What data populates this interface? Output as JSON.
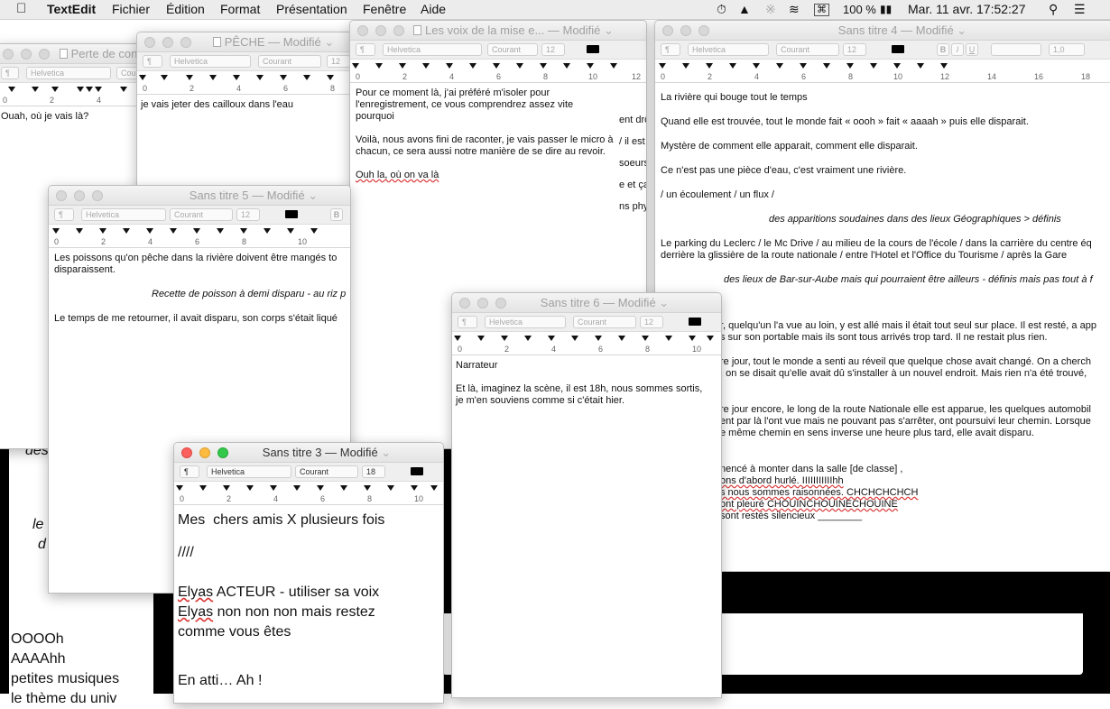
{
  "menubar": {
    "apple_icon": "apple-logo",
    "app_name": "TextEdit",
    "menus": [
      "Fichier",
      "Édition",
      "Format",
      "Présentation",
      "Fenêtre",
      "Aide"
    ],
    "status": {
      "battery": "100 %",
      "clock": "Mar. 11 avr.  17:52:27"
    }
  },
  "formatbar": {
    "style": "¶",
    "font": "Helvetica",
    "weight": "Courant",
    "size_12": "12",
    "size_18": "18",
    "bold": "B",
    "italic": "I",
    "underline": "U",
    "spacing": "1,0"
  },
  "windows": {
    "perte": {
      "title": "Perte de con",
      "lines": [
        "Ouah, où je vais là?"
      ]
    },
    "peche": {
      "title": "PÊCHE — Modifié",
      "lines": [
        "je vais jeter des cailloux dans l'eau"
      ]
    },
    "voix": {
      "title": "Les voix de la mise e... — Modifié",
      "paragraphs": [
        "Pour ce moment là, j'ai préféré m'isoler pour l'enregistrement, ce vous comprendrez assez vite pourquoi",
        "Voilà, nous avons fini de raconter, je vais passer le micro à chacun, ce sera aussi notre manière de se dire au revoir.",
        "Ouh la, où on va là"
      ],
      "peek_lines": [
        "ent drôle",
        "/ il est c",
        "soeurs c",
        "e et ça r",
        "ns phys"
      ]
    },
    "sans4": {
      "title": "Sans titre 4 — Modifié",
      "paragraphs": [
        "La rivière qui bouge tout le temps",
        "Quand elle est trouvée, tout le monde fait « oooh » fait « aaaah » puis elle disparait.",
        "Mystère de comment elle apparait, comment elle disparait.",
        "Ce n'est pas une pièce d'eau, c'est vraiment une rivière.",
        "/ un écoulement / un flux /"
      ],
      "center1": "des apparitions soudaines dans des lieux Géographiques > définis",
      "parking": "Le parking du Leclerc / le Mc Drive / au milieu de la cours de l'école / dans la carrière du centre éq",
      "parking2": "derrière la glissière de la route nationale / entre l'Hotel et l'Office du Tourisme / après la Gare",
      "center2": "des lieux de Bar-sur-Aube mais qui pourraient être ailleurs - définis mais pas tout à f",
      "visible_lines": [
        "r, quelqu'un l'a vue au loin, y est allé mais il était tout seul sur place. Il est resté, a app",
        "s sur son portable mais ils sont tous arrivés trop tard. Il ne restait plus rien.",
        "re jour, tout le monde a senti au réveil que quelque chose avait changé. On a cherch",
        ", on se disait qu'elle avait dû s'installer à un nouvel endroit. Mais rien n'a été trouvé,",
        "re jour encore, le long de la route Nationale elle est apparue, les quelques automobil",
        "ent par là l'ont vue mais ne pouvant pas s'arrêter, ont poursuivi leur chemin. Lorsque",
        "e même chemin en sens inverse une heure plus tard, elle avait disparu.",
        "nencé à monter dans la salle [de classe] ,",
        "ons d'abord hurlé. IIIIIIIIIIIhh",
        "s nous sommes raisonnées. CHCHCHCHCH",
        "ont pleuré CHOUINCHOUINECHOUINE",
        "sont restés silencieux ________"
      ]
    },
    "sans5": {
      "title": "Sans titre 5 — Modifié",
      "line1": "Les poissons qu'on pêche dans la rivière doivent être mangés to",
      "line2": "disparaissent.",
      "center": "Recette de poisson à demi disparu - au riz p",
      "line3": "Le temps de me retourner, il avait disparu, son corps s'était liqué"
    },
    "sans6": {
      "title": "Sans titre 6 — Modifié",
      "lines": [
        "Narrateur",
        "",
        "Et là, imaginez la scène, il est 18h, nous sommes sortis,",
        "je m'en souviens comme si c'était hier."
      ]
    },
    "sans3": {
      "title": "Sans titre 3 — Modifié",
      "line1": "Mes  chers amis X plusieurs fois",
      "line2": "////",
      "line3a": "Elyas",
      "line3b": " ACTEUR - utiliser sa voix",
      "line4a": "Elyas",
      "line4b": " non non non mais restez",
      "line5": "comme vous êtes",
      "line6": "En atti… Ah !"
    }
  },
  "background": {
    "frag1": "des",
    "frag2": "le",
    "frag3": "d",
    "list": [
      "OOOOh",
      "AAAAhh",
      "petites musiques",
      "le thème du univ"
    ]
  }
}
